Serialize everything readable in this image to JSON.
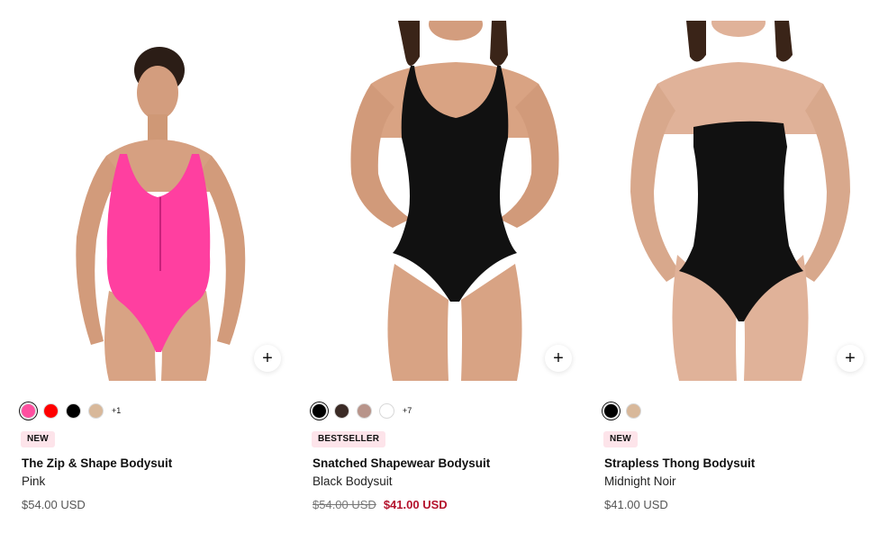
{
  "products": [
    {
      "badge": "NEW",
      "title": "The Zip & Shape Bodysuit",
      "variant": "Pink",
      "price": "$54.00 USD",
      "swatches": [
        "#ff4fa0",
        "#ff0000",
        "#000000",
        "#d8b89a"
      ],
      "more": "+1",
      "add_icon": "plus-icon"
    },
    {
      "badge": "BESTSELLER",
      "title": "Snatched Shapewear Bodysuit",
      "variant": "Black Bodysuit",
      "compare_price": "$54.00 USD",
      "sale_price": "$41.00 USD",
      "swatches": [
        "#000000",
        "#3b2b26",
        "#b8948a",
        "#ffffff"
      ],
      "more": "+7",
      "add_icon": "plus-icon"
    },
    {
      "badge": "NEW",
      "title": "Strapless Thong Bodysuit",
      "variant": "Midnight Noir",
      "price": "$41.00 USD",
      "swatches": [
        "#000000",
        "#d8b89a"
      ],
      "add_icon": "plus-icon"
    }
  ],
  "colors": {
    "badge_bg": "#fde4ea",
    "sale": "#b4122c",
    "skin": "#d9a383",
    "pink_suit": "#ff3fa0"
  }
}
